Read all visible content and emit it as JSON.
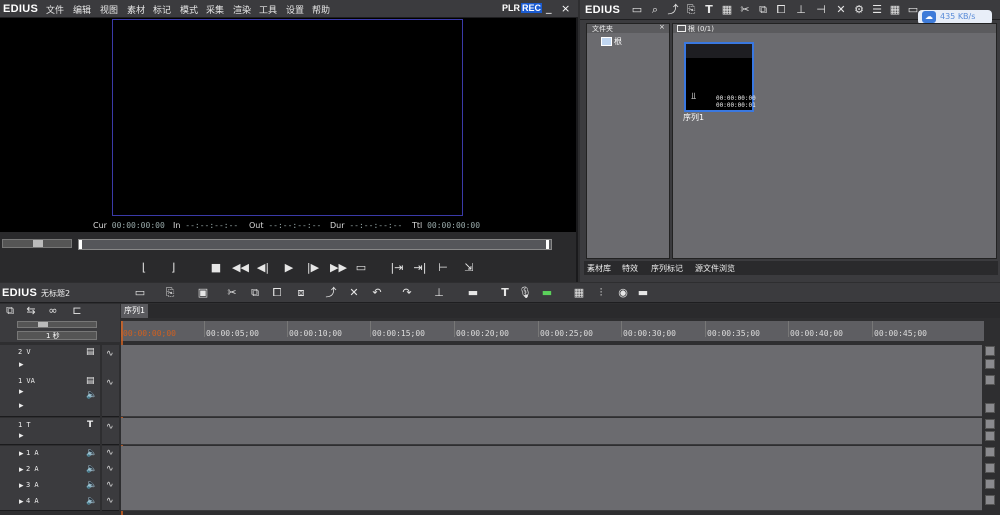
{
  "player": {
    "logo": "EDIUS",
    "menu": [
      "文件",
      "编辑",
      "视图",
      "素材",
      "标记",
      "模式",
      "采集",
      "渲染",
      "工具",
      "设置",
      "帮助"
    ],
    "plr_label": "PLR",
    "rec_label": "REC",
    "minimize": "_",
    "close": "×",
    "timecodes": {
      "cur_label": "Cur",
      "cur_value": "00:00:00:00",
      "in_label": "In",
      "in_value": "--:--:--:--",
      "out_label": "Out",
      "out_value": "--:--:--:--",
      "dur_label": "Dur",
      "dur_value": "--:--:--:--",
      "ttl_label": "Ttl",
      "ttl_value": "00:00:00:00"
    }
  },
  "bin": {
    "logo": "EDIUS",
    "speed_badge": "435 KB/s",
    "folder_panel_title": "文件夹",
    "folder_root": "根",
    "content_title": "根 (0/1)",
    "clip_tc1": "00:00:00:00",
    "clip_tc2": "00:00:00:01",
    "clip_name": "序列1",
    "tabs": [
      "素材库",
      "特效",
      "序列标记",
      "源文件浏览"
    ]
  },
  "timeline": {
    "logo": "EDIUS",
    "project_name": "无标题2",
    "sequence_tab": "序列1",
    "scale_label": "1 秒",
    "ruler": [
      "00:00:00;00",
      "00:00:05;00",
      "00:00:10;00",
      "00:00:15;00",
      "00:00:20;00",
      "00:00:25;00",
      "00:00:30;00",
      "00:00:35;00",
      "00:00:40;00",
      "00:00:45;00"
    ],
    "tracks": [
      {
        "name": "2 V"
      },
      {
        "name": "1 VA"
      },
      {
        "name": "1 T"
      },
      {
        "name": "1 A"
      },
      {
        "name": "2 A"
      },
      {
        "name": "3 A"
      },
      {
        "name": "4 A"
      }
    ]
  },
  "colors": {
    "accent_rec": "#1a5bd1",
    "monitor_frame": "#3a3aa8",
    "playhead": "#d06020",
    "panel_bg": "#6b6b6f"
  }
}
